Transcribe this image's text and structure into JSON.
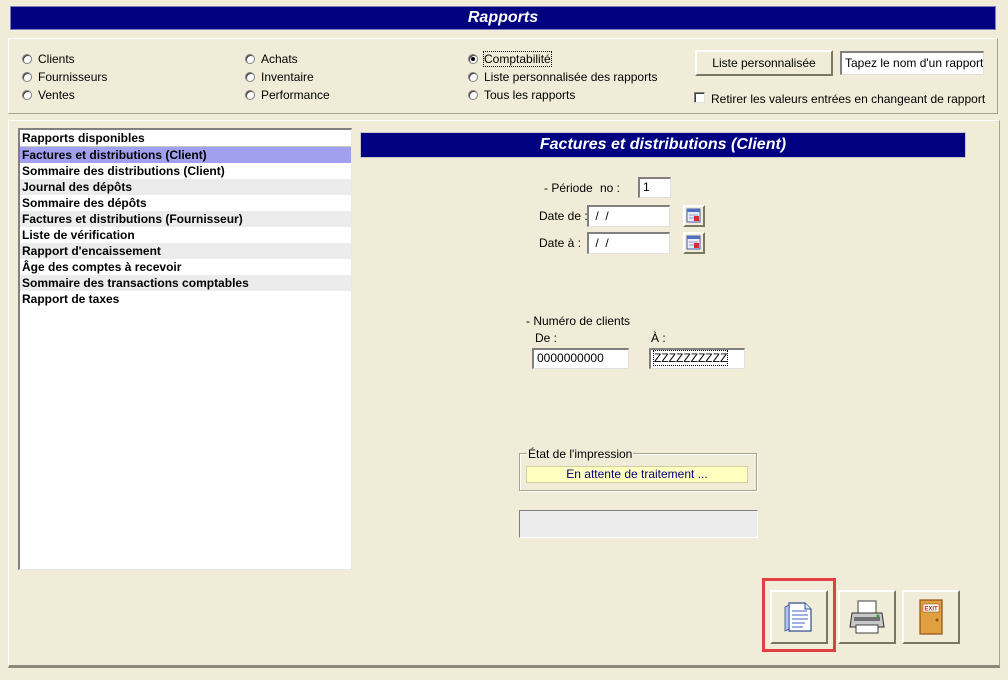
{
  "title": "Rapports",
  "options": {
    "col1": [
      {
        "label": "Clients",
        "checked": false
      },
      {
        "label": "Fournisseurs",
        "checked": false
      },
      {
        "label": "Ventes",
        "checked": false
      }
    ],
    "col2": [
      {
        "label": "Achats",
        "checked": false
      },
      {
        "label": "Inventaire",
        "checked": false
      },
      {
        "label": "Performance",
        "checked": false
      }
    ],
    "col3": [
      {
        "label": "Comptabilité",
        "checked": true
      },
      {
        "label": "Liste personnalisée des rapports",
        "checked": false
      },
      {
        "label": "Tous les rapports",
        "checked": false
      }
    ],
    "custom_list_button": "Liste personnalisée",
    "report_name_placeholder": "Tapez le nom d'un rapport",
    "reset_values_checkbox": "Retirer les valeurs entrées en changeant de rapport"
  },
  "report_list": {
    "header": "Rapports disponibles",
    "items": [
      "Factures et distributions (Client)",
      "Sommaire des distributions (Client)",
      "Journal des dépôts",
      "Sommaire des dépôts",
      "Factures et distributions (Fournisseur)",
      "Liste de vérification",
      "Rapport d'encaissement",
      "Âge des comptes à recevoir",
      "Sommaire des transactions comptables",
      "Rapport de taxes"
    ],
    "selected_index": 0
  },
  "form": {
    "section_title": "Factures et distributions (Client)",
    "period_label": "- Période",
    "period_no_label": "no :",
    "period_no_value": "1",
    "date_from_label": "Date de :",
    "date_from_value": " /  /",
    "date_to_label": "Date à :",
    "date_to_value": " /  /",
    "client_group_label": "- Numéro de clients",
    "from_label": "De :",
    "to_label": "À :",
    "from_value": "0000000000",
    "to_value": "ZZZZZZZZZZ",
    "print_status_label": "État de l'impression",
    "print_status_value": "En attente de traitement ...",
    "progress_text": ""
  },
  "buttons": {
    "preview": "preview-report-icon",
    "print": "printer-icon",
    "exit": "exit-door-icon",
    "exit_text": "EXIT"
  }
}
